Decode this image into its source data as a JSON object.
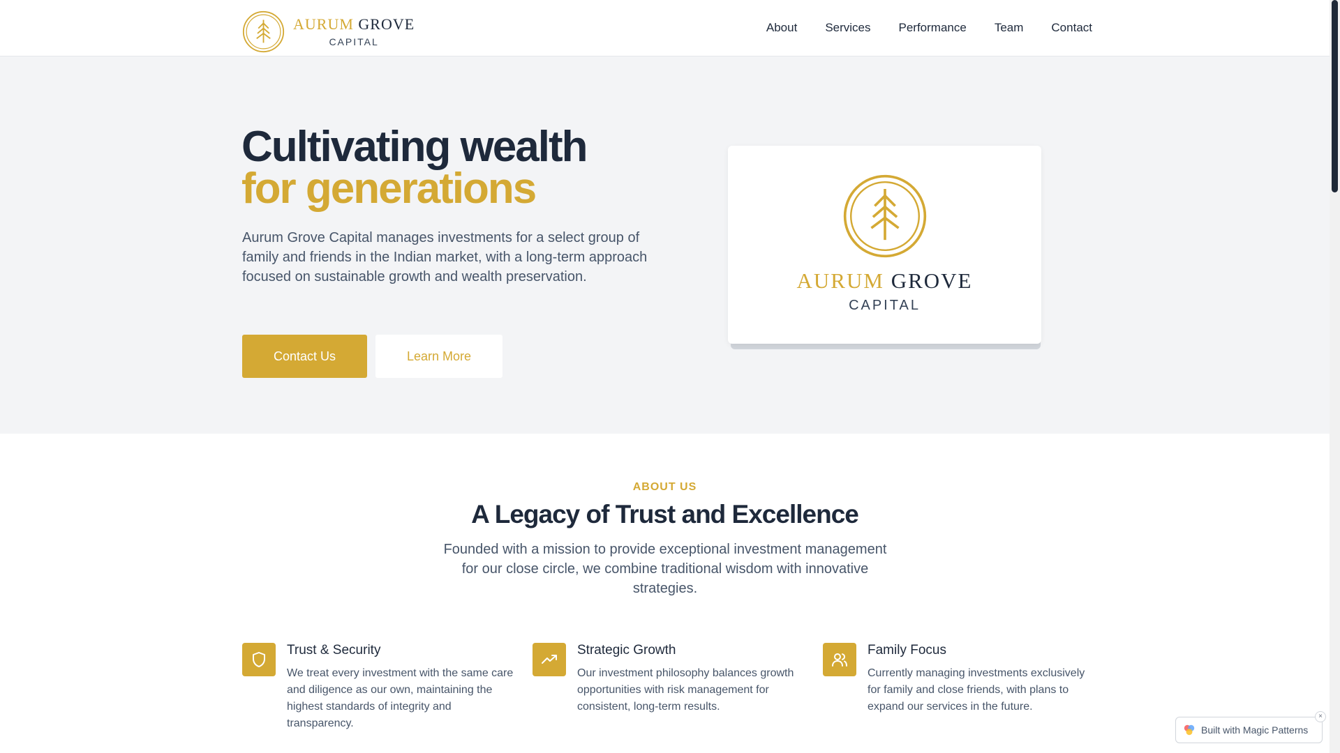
{
  "brand": {
    "word1": "AURUM",
    "word2": "GROVE",
    "sub": "CAPITAL"
  },
  "nav": [
    {
      "label": "About"
    },
    {
      "label": "Services"
    },
    {
      "label": "Performance"
    },
    {
      "label": "Team"
    },
    {
      "label": "Contact"
    }
  ],
  "hero": {
    "title_line1": "Cultivating wealth",
    "title_line2": "for generations",
    "description": "Aurum Grove Capital manages investments for a select group of family and friends in the Indian market, with a long-term approach focused on sustainable growth and wealth preservation.",
    "primary_button": "Contact Us",
    "secondary_button": "Learn More",
    "card": {
      "word1": "AURUM",
      "word2": "GROVE",
      "sub": "CAPITAL"
    }
  },
  "about": {
    "eyebrow": "ABOUT US",
    "title": "A Legacy of Trust and Excellence",
    "description": "Founded with a mission to provide exceptional investment management for our close circle, we combine traditional wisdom with innovative strategies.",
    "features": [
      {
        "icon": "shield-icon",
        "title": "Trust & Security",
        "description": "We treat every investment with the same care and diligence as our own, maintaining the highest standards of integrity and transparency."
      },
      {
        "icon": "trending-up-icon",
        "title": "Strategic Growth",
        "description": "Our investment philosophy balances growth opportunities with risk management for consistent, long-term results."
      },
      {
        "icon": "users-icon",
        "title": "Family Focus",
        "description": "Currently managing investments exclusively for family and close friends, with plans to expand our services in the future."
      }
    ]
  },
  "badge": {
    "label": "Built with Magic Patterns",
    "close": "×"
  },
  "colors": {
    "gold": "#d4a934",
    "navy": "#1e293b",
    "hero_bg": "#f3f4f6"
  }
}
